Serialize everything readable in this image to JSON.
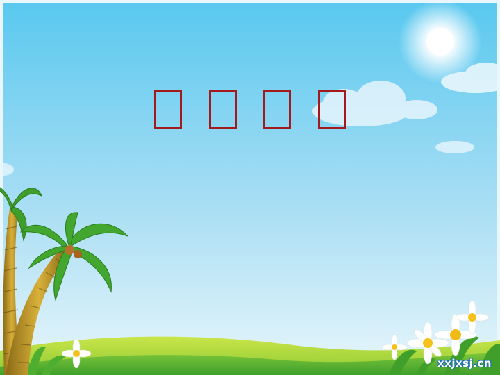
{
  "slide": {
    "title_chars": [
      "□",
      "□",
      "□",
      "□"
    ],
    "watermark": "xxjxsj.cn"
  },
  "colors": {
    "sky_top": "#58c8ef",
    "sky_bottom": "#e6f5fb",
    "title": "#a3191c",
    "grass_light": "#b7dd3f",
    "grass_dark": "#5fb82e"
  },
  "decor": [
    "sun",
    "clouds",
    "palm-trees",
    "daisies",
    "grass-hills"
  ]
}
